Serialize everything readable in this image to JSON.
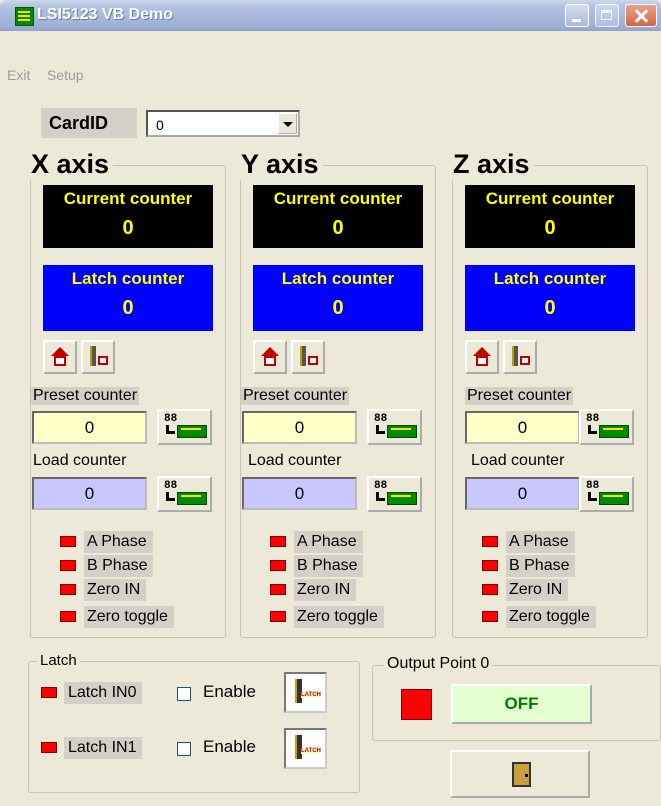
{
  "window": {
    "title": "LSI5123 VB Demo"
  },
  "menu": {
    "exit": "Exit",
    "setup": "Setup"
  },
  "card": {
    "label": "CardID",
    "value": "0"
  },
  "axes": [
    {
      "title": "X axis",
      "current_label": "Current counter",
      "current_value": "0",
      "latch_label": "Latch counter",
      "latch_value": "0",
      "preset_label": "Preset counter",
      "preset_value": "0",
      "load_label": "Load counter",
      "load_value": "0",
      "signals": [
        "A Phase",
        "B Phase",
        "Zero IN",
        "Zero toggle"
      ]
    },
    {
      "title": "Y axis",
      "current_label": "Current counter",
      "current_value": "0",
      "latch_label": "Latch counter",
      "latch_value": "0",
      "preset_label": "Preset counter",
      "preset_value": "0",
      "load_label": "Load counter",
      "load_value": "0",
      "signals": [
        "A Phase",
        "B Phase",
        "Zero IN",
        "Zero toggle"
      ]
    },
    {
      "title": "Z axis",
      "current_label": "Current counter",
      "current_value": "0",
      "latch_label": "Latch counter",
      "latch_value": "0",
      "preset_label": "Preset counter",
      "preset_value": "0",
      "load_label": "Load counter",
      "load_value": "0",
      "signals": [
        "A Phase",
        "B Phase",
        "Zero IN",
        "Zero toggle"
      ]
    }
  ],
  "latch": {
    "title": "Latch",
    "rows": [
      {
        "label": "Latch IN0",
        "enable_label": "Enable",
        "button_text": "LATCH"
      },
      {
        "label": "Latch IN1",
        "enable_label": "Enable",
        "button_text": "LATCH"
      }
    ]
  },
  "output": {
    "title": "Output Point 0",
    "button_label": "OFF"
  },
  "colors": {
    "led_on": "#ff0000",
    "current_bg": "#000000",
    "latch_bg": "#0000ff",
    "counter_text": "#ffff00",
    "preset_bg": "#ffffc8",
    "load_bg": "#c8c8ff"
  },
  "icons": {
    "home": "home-icon",
    "home_switch": "home-switch-icon",
    "load": "load-to-card-icon",
    "latch": "latch-icon",
    "exit": "door-icon"
  }
}
